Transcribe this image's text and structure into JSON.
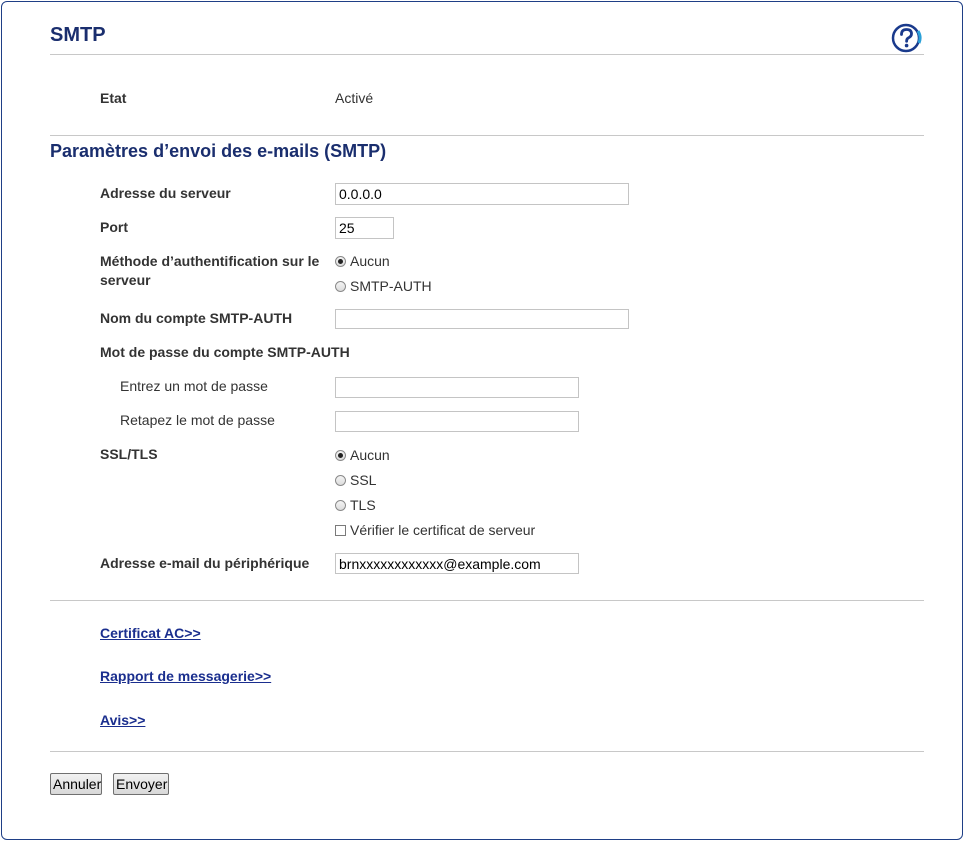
{
  "header": {
    "title": "SMTP",
    "help_icon": "help-question-icon"
  },
  "status": {
    "label": "Etat",
    "value": "Activé"
  },
  "section": {
    "title": "Paramètres d’envoi des e-mails (SMTP)"
  },
  "server": {
    "label": "Adresse du serveur",
    "value": "0.0.0.0"
  },
  "port": {
    "label": "Port",
    "value": "25"
  },
  "auth": {
    "label_line1": "Méthode d’authentification sur le",
    "label_line2": "serveur",
    "options": [
      {
        "label": "Aucun",
        "checked": true
      },
      {
        "label": "SMTP-AUTH",
        "checked": false
      }
    ]
  },
  "account": {
    "label": "Nom du compte SMTP-AUTH",
    "value": ""
  },
  "password": {
    "label": "Mot de passe du compte SMTP-AUTH",
    "enter_label": "Entrez un mot de passe",
    "retype_label": "Retapez le mot de passe"
  },
  "ssl": {
    "label": "SSL/TLS",
    "options": [
      {
        "label": "Aucun",
        "checked": true
      },
      {
        "label": "SSL",
        "checked": false
      },
      {
        "label": "TLS",
        "checked": false
      }
    ],
    "verify_label": "Vérifier le certificat de serveur",
    "verify_checked": false
  },
  "device_email": {
    "label": "Adresse e-mail du périphérique",
    "value": "brnxxxxxxxxxxxx@example.com"
  },
  "links": {
    "ca_cert": "Certificat AC>>",
    "mail_report": "Rapport de messagerie>>",
    "notice": "Avis>>"
  },
  "buttons": {
    "cancel": "Annuler",
    "submit": "Envoyer"
  },
  "colors": {
    "accent": "#1a2e6e",
    "link": "#1a2e8e",
    "frame_border": "#1f3f86"
  }
}
